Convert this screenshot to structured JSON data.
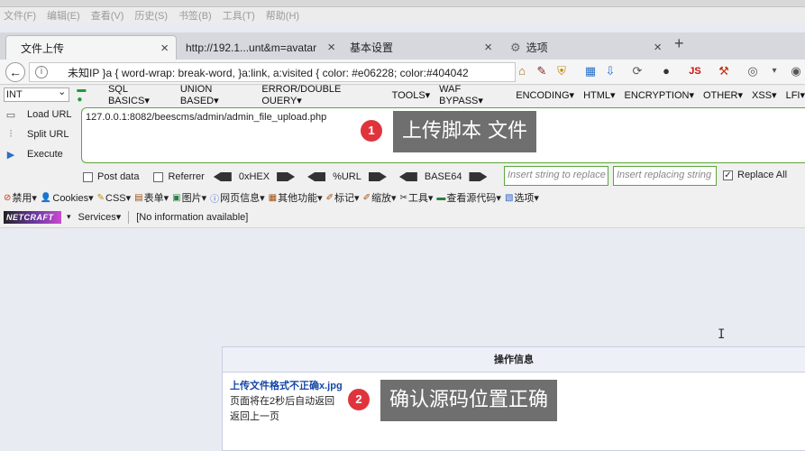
{
  "menubar": [
    "文件(F)",
    "编辑(E)",
    "查看(V)",
    "历史(S)",
    "书签(B)",
    "工具(T)",
    "帮助(H)"
  ],
  "tabs": [
    {
      "label": "文件上传",
      "active": true
    },
    {
      "label": "http://192.1...unt&m=avatar",
      "active": false
    },
    {
      "label": "基本设置",
      "active": false
    },
    {
      "label": "选项",
      "active": false
    }
  ],
  "navbar": {
    "address": "未知IP }a { word-wrap: break-word, }a:link, a:visited { color: #e06228; color:#404042",
    "js_label": "JS"
  },
  "hackbar": {
    "type_select": "INT",
    "menu": [
      "SQL BASICS▾",
      "UNION BASED▾",
      "ERROR/DOUBLE QUERY▾",
      "TOOLS▾",
      "WAF BYPASS▾",
      "ENCODING▾",
      "HTML▾",
      "ENCRYPTION▾",
      "OTHER▾",
      "XSS▾",
      "LFI▾"
    ],
    "load_url": "Load URL",
    "split_url": "Split URL",
    "execute": "Execute",
    "url_value": "127.0.0.1:8082/beescms/admin/admin_file_upload.php",
    "post_data": "Post data",
    "referrer": "Referrer",
    "hex": "0xHEX",
    "url_enc": "%URL",
    "base64": "BASE64",
    "insert_placeholder": "Insert string to replace",
    "replacing_placeholder": "Insert replacing string",
    "replace_all": "Replace All"
  },
  "firebug": [
    "禁用▾",
    "Cookies▾",
    "CSS▾",
    "表单▾",
    "图片▾",
    "网页信息▾",
    "其他功能▾",
    "标记▾",
    "缩放▾",
    "工具▾",
    "查看源代码▾",
    "选项▾"
  ],
  "netcraft": {
    "logo": "NETCRAFT",
    "services": "Services▾",
    "info": "[No information available]"
  },
  "panel": {
    "title": "操作信息",
    "message": "上传文件格式不正确x.jpg",
    "line2": "页面将在2秒后自动返回",
    "line3": "返回上一页"
  },
  "callouts": [
    {
      "num": "1",
      "text": "上传脚本 文件"
    },
    {
      "num": "2",
      "text": "确认源码位置正确"
    }
  ],
  "colors": {
    "badge": "#e0343d",
    "callout_bg": "#6f6f6f",
    "hackbar_border": "#5aa83a",
    "link_blue": "#1546a8"
  }
}
